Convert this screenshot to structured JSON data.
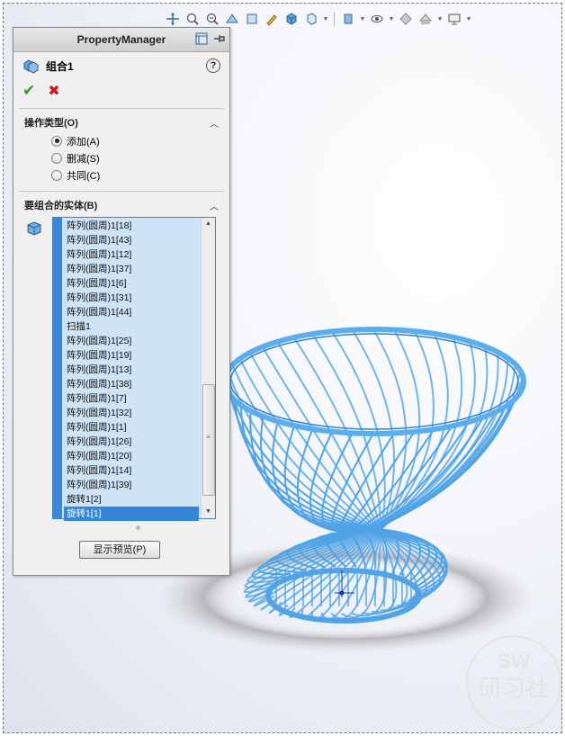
{
  "panel": {
    "title": "PropertyManager",
    "feature_title": "组合1",
    "help_label": "?"
  },
  "operation_group": {
    "title": "操作类型(O)",
    "options": [
      {
        "label": "添加(A)",
        "selected": true
      },
      {
        "label": "删减(S)",
        "selected": false
      },
      {
        "label": "共同(C)",
        "selected": false
      }
    ]
  },
  "bodies_group": {
    "title": "要组合的实体(B)",
    "items": [
      "阵列(圆周)1[18]",
      "阵列(圆周)1[43]",
      "阵列(圆周)1[12]",
      "阵列(圆周)1[37]",
      "阵列(圆周)1[6]",
      "阵列(圆周)1[31]",
      "阵列(圆周)1[44]",
      "扫描1",
      "阵列(圆周)1[25]",
      "阵列(圆周)1[19]",
      "阵列(圆周)1[13]",
      "阵列(圆周)1[38]",
      "阵列(圆周)1[7]",
      "阵列(圆周)1[32]",
      "阵列(圆周)1[1]",
      "阵列(圆周)1[26]",
      "阵列(圆周)1[20]",
      "阵列(圆周)1[14]",
      "阵列(圆周)1[39]",
      "旋转1[2]",
      "旋转1[1]"
    ],
    "selected_item": "旋转1[1]"
  },
  "preview_button": "显示预览(P)",
  "colors": {
    "model_blue": "#4fa3e6",
    "accent_blue": "#3585d6",
    "ok_green": "#2d9b1b",
    "cancel_red": "#d01616"
  },
  "toolbar": {
    "icons": [
      "zoom-to-fit-icon",
      "zoom-area-icon",
      "previous-view-icon",
      "section-view-icon",
      "dynamic-annotation-icon",
      "view-orientation-icon",
      "display-style-icon",
      "hide-show-icon",
      "edit-appearance-icon",
      "apply-scene-icon",
      "view-settings-icon"
    ]
  },
  "watermark": {
    "line1": "SW",
    "line2": "研习社",
    "line3": "SolidWorks"
  }
}
